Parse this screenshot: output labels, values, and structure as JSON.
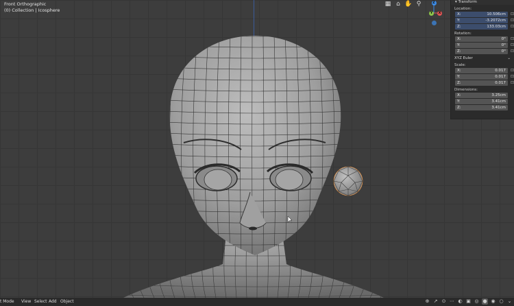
{
  "viewport": {
    "view_name": "Front Orthographic",
    "collection": "(0) Collection | Icosphere"
  },
  "nav_icons": [
    "grid-icon",
    "camera-icon",
    "hand-icon",
    "zoom-icon"
  ],
  "gizmo": {
    "z": "Z",
    "y": "Y",
    "x": "X"
  },
  "transform_panel": {
    "header": "Transform",
    "location_label": "Location:",
    "location": [
      {
        "axis": "X:",
        "value": "10.506cm"
      },
      {
        "axis": "Y:",
        "value": "-3.2072cm"
      },
      {
        "axis": "Z:",
        "value": "133.03cm"
      }
    ],
    "rotation_label": "Rotation:",
    "rotation": [
      {
        "axis": "X:",
        "value": "0°"
      },
      {
        "axis": "Y:",
        "value": "0°"
      },
      {
        "axis": "Z:",
        "value": "0°"
      }
    ],
    "rotation_mode": "XYZ Euler",
    "scale_label": "Scale:",
    "scale": [
      {
        "axis": "X:",
        "value": "0.017"
      },
      {
        "axis": "Y:",
        "value": "0.017"
      },
      {
        "axis": "Z:",
        "value": "0.017"
      }
    ],
    "dimensions_label": "Dimensions:",
    "dimensions": [
      {
        "axis": "X:",
        "value": "3.25cm"
      },
      {
        "axis": "Y:",
        "value": "3.41cm"
      },
      {
        "axis": "Z:",
        "value": "3.41cm"
      }
    ]
  },
  "header": {
    "mode": "t Mode",
    "menus": [
      "View",
      "Select",
      "Add",
      "Object"
    ]
  },
  "colors": {
    "x_axis": "#e05454",
    "y_axis": "#8bc34a",
    "z_axis": "#3c8ce7"
  }
}
